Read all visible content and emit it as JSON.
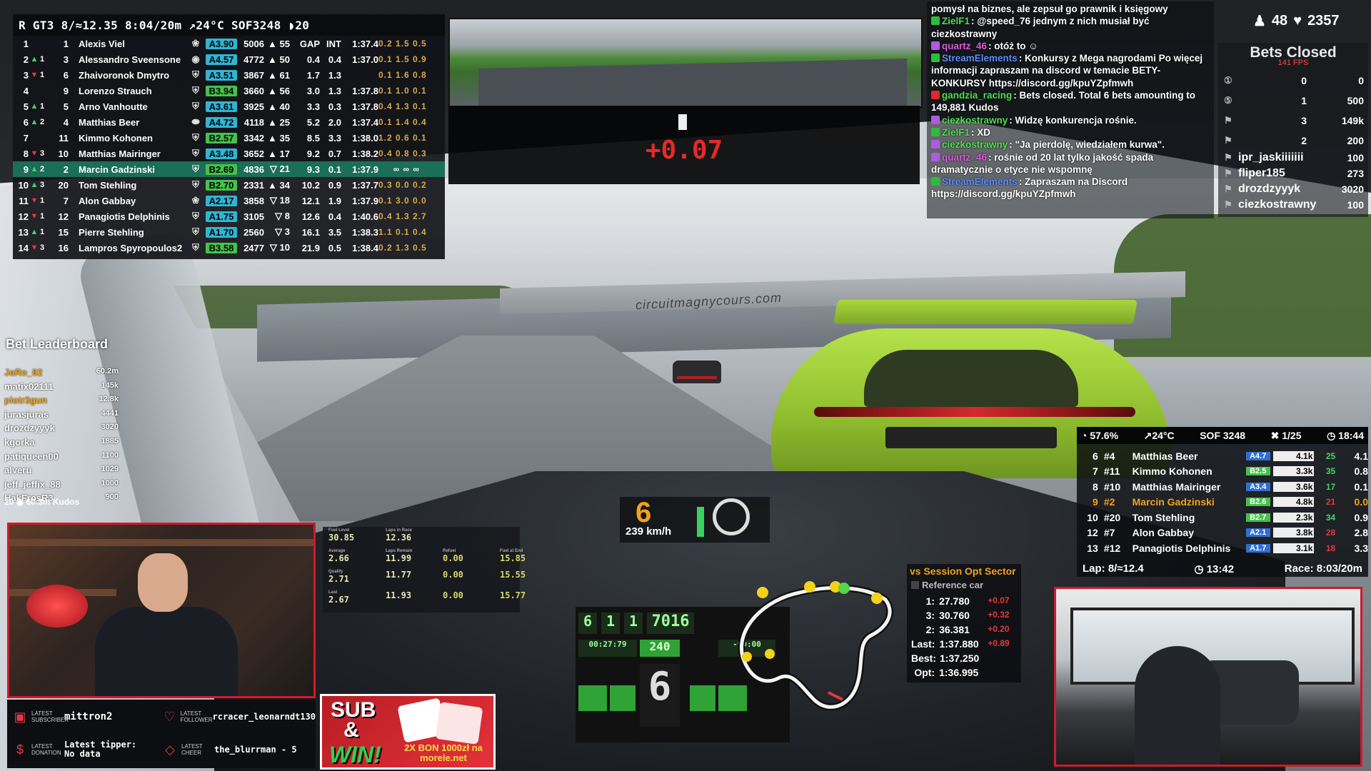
{
  "standings": {
    "header": "R GT3 8/≈12.35 8:04/20m ↗24°C SOF3248 ◗20",
    "col_gap": "GAP",
    "col_int": "INT",
    "rows": [
      {
        "pos": "1",
        "arrow": "",
        "chg": "",
        "num": "1",
        "name": "Alexis Viel",
        "brand": "❀",
        "lic": "A3.90",
        "lic_color": "#2fb5d4",
        "ir": "5006",
        "ir_arrow": "▲",
        "irchg": "55",
        "gap": "GAP",
        "int": "INT",
        "lap": "1:37.4",
        "secs": "0.2 1.5 0.5",
        "hl": false
      },
      {
        "pos": "2",
        "arrow": "▲",
        "chg": "1",
        "num": "3",
        "name": "Alessandro Sveensone",
        "brand": "◉",
        "lic": "A4.57",
        "lic_color": "#2fb5d4",
        "ir": "4772",
        "ir_arrow": "▲",
        "irchg": "50",
        "gap": "0.4",
        "int": "0.4",
        "lap": "1:37.0",
        "secs": "0.1 1.5 0.9",
        "hl": false
      },
      {
        "pos": "3",
        "arrow": "▼",
        "chg": "1",
        "num": "6",
        "name": "Zhaivoronok Dmytro",
        "brand": "⛨",
        "lic": "A3.51",
        "lic_color": "#2fb5d4",
        "ir": "3867",
        "ir_arrow": "▲",
        "irchg": "61",
        "gap": "1.7",
        "int": "1.3",
        "lap": "",
        "secs": "0.1 1.6 0.8",
        "hl": false
      },
      {
        "pos": "4",
        "arrow": "",
        "chg": "",
        "num": "9",
        "name": "Lorenzo Strauch",
        "brand": "⛨",
        "lic": "B3.94",
        "lic_color": "#44c24a",
        "ir": "3660",
        "ir_arrow": "▲",
        "irchg": "56",
        "gap": "3.0",
        "int": "1.3",
        "lap": "1:37.8",
        "secs": "0.1 1.0 0.1",
        "hl": false
      },
      {
        "pos": "5",
        "arrow": "▲",
        "chg": "1",
        "num": "5",
        "name": "Arno Vanhoutte",
        "brand": "⛨",
        "lic": "A3.61",
        "lic_color": "#2fb5d4",
        "ir": "3925",
        "ir_arrow": "▲",
        "irchg": "40",
        "gap": "3.3",
        "int": "0.3",
        "lap": "1:37.8",
        "secs": "0.4 1.3 0.1",
        "hl": false
      },
      {
        "pos": "6",
        "arrow": "▲",
        "chg": "2",
        "num": "4",
        "name": "Matthias Beer",
        "brand": "⬬",
        "lic": "A4.72",
        "lic_color": "#2fb5d4",
        "ir": "4118",
        "ir_arrow": "▲",
        "irchg": "25",
        "gap": "5.2",
        "int": "2.0",
        "lap": "1:37.4",
        "secs": "0.1 1.4 0.4",
        "hl": false
      },
      {
        "pos": "7",
        "arrow": "",
        "chg": "",
        "num": "11",
        "name": "Kimmo Kohonen",
        "brand": "⛨",
        "lic": "B2.57",
        "lic_color": "#44c24a",
        "ir": "3342",
        "ir_arrow": "▲",
        "irchg": "35",
        "gap": "8.5",
        "int": "3.3",
        "lap": "1:38.0",
        "secs": "1.2 0.6 0.1",
        "hl": false
      },
      {
        "pos": "8",
        "arrow": "▼",
        "chg": "3",
        "num": "10",
        "name": "Matthias Mairinger",
        "brand": "⛨",
        "lic": "A3.48",
        "lic_color": "#2fb5d4",
        "ir": "3652",
        "ir_arrow": "▲",
        "irchg": "17",
        "gap": "9.2",
        "int": "0.7",
        "lap": "1:38.2",
        "secs": "0.4 0.8 0.3",
        "hl": false
      },
      {
        "pos": "9",
        "arrow": "▲",
        "chg": "2",
        "num": "2",
        "name": "Marcin Gadzinski",
        "brand": "⛨",
        "lic": "B2.69",
        "lic_color": "#44c24a",
        "ir": "4836",
        "ir_arrow": "▼",
        "irchg": "21",
        "gap": "9.3",
        "int": "0.1",
        "lap": "1:37.9",
        "secs": "∞ ∞ ∞",
        "hl": true
      },
      {
        "pos": "10",
        "arrow": "▲",
        "chg": "3",
        "num": "20",
        "name": "Tom Stehling",
        "brand": "⛨",
        "lic": "B2.70",
        "lic_color": "#44c24a",
        "ir": "2331",
        "ir_arrow": "▲",
        "irchg": "34",
        "gap": "10.2",
        "int": "0.9",
        "lap": "1:37.7",
        "secs": "0.3 0.0 0.2",
        "hl": false
      },
      {
        "pos": "11",
        "arrow": "▼",
        "chg": "1",
        "num": "7",
        "name": "Alon Gabbay",
        "brand": "❀",
        "lic": "A2.17",
        "lic_color": "#2fb5d4",
        "ir": "3858",
        "ir_arrow": "▼",
        "irchg": "18",
        "gap": "12.1",
        "int": "1.9",
        "lap": "1:37.9",
        "secs": "0.1 3.0 0.0",
        "hl": false
      },
      {
        "pos": "12",
        "arrow": "▼",
        "chg": "1",
        "num": "12",
        "name": "Panagiotis Delphinis",
        "brand": "⛨",
        "lic": "A1.75",
        "lic_color": "#2fb5d4",
        "ir": "3105",
        "ir_arrow": "▼",
        "irchg": "8",
        "gap": "12.6",
        "int": "0.4",
        "lap": "1:40.6",
        "secs": "0.4 1.3 2.7",
        "hl": false
      },
      {
        "pos": "13",
        "arrow": "▲",
        "chg": "1",
        "num": "15",
        "name": "Pierre Stehling",
        "brand": "⛨",
        "lic": "A1.70",
        "lic_color": "#2fb5d4",
        "ir": "2560",
        "ir_arrow": "▼",
        "irchg": "3",
        "gap": "16.1",
        "int": "3.5",
        "lap": "1:38.3",
        "secs": "1.1 0.1 0.4",
        "hl": false
      },
      {
        "pos": "14",
        "arrow": "▼",
        "chg": "3",
        "num": "16",
        "name": "Lampros Spyropoulos2",
        "brand": "⛨",
        "lic": "B3.58",
        "lic_color": "#44c24a",
        "ir": "2477",
        "ir_arrow": "▼",
        "irchg": "10",
        "gap": "21.9",
        "int": "0.5",
        "lap": "1:38.4",
        "secs": "0.2 1.3 0.5",
        "hl": false
      }
    ]
  },
  "delta": {
    "value": "+0.07"
  },
  "scene": {
    "bridge_text": "circuitmagnycours.com"
  },
  "chat": [
    {
      "user": "",
      "user_color": "#ffffff",
      "badge": "",
      "text": "pomysł na biznes, ale zepsuł go prawnik i księgowy"
    },
    {
      "user": "ZielF1",
      "user_color": "#4fe04f",
      "badge": "#2ebd3b",
      "text": ": @speed_76 jednym z nich musiał być ciezkostrawny"
    },
    {
      "user": "quartz_46",
      "user_color": "#e05ae0",
      "badge": "#b05ae0",
      "text": ": otóż to ☺"
    },
    {
      "user": "StreamElements",
      "user_color": "#5a8cff",
      "badge": "#2ebd3b",
      "text": ": Konkursy z Mega nagrodami Po więcej informacji zapraszam na discord w temacie BETY-KONKURSY https://discord.gg/kpuYZpfmwh"
    },
    {
      "user": "gandzia_racing",
      "user_color": "#4fe04f",
      "badge": "#e0282a",
      "text": ": Bets closed. Total 6 bets amounting to 149,881 Kudos"
    },
    {
      "user": "ciezkostrawny",
      "user_color": "#4fe04f",
      "badge": "#b05ae0",
      "text": ": Widzę konkurencja rośnie."
    },
    {
      "user": "ZielF1",
      "user_color": "#4fe04f",
      "badge": "#2ebd3b",
      "text": ": XD"
    },
    {
      "user": "ciezkostrawny",
      "user_color": "#4fe04f",
      "badge": "#b05ae0",
      "text": ": \"Ja pierdolę, wiedziałem kurwa\"."
    },
    {
      "user": "quartz_46",
      "user_color": "#e05ae0",
      "badge": "#b05ae0",
      "text": ": rośnie od 20 lat tylko jakość spada dramatycznie o etyce nie wspomnę"
    },
    {
      "user": "StreamElements",
      "user_color": "#5a8cff",
      "badge": "#2ebd3b",
      "text": ": Zapraszam na Discord https://discord.gg/kpuYZpfmwh"
    }
  ],
  "viewers": {
    "count": "48",
    "hearts": "2357"
  },
  "bets": {
    "title": "Bets Closed",
    "fps": "141 FPS",
    "stats": [
      {
        "icon": "①",
        "name": "0",
        "value": "0"
      },
      {
        "icon": "⑤",
        "name": "1",
        "value": "500"
      },
      {
        "icon": "⚑",
        "name": "3",
        "value": "149k"
      },
      {
        "icon": "⚑",
        "name": "2",
        "value": "200"
      }
    ],
    "users": [
      {
        "name": "ipr_jaskiiiiiii",
        "value": "100"
      },
      {
        "name": "fliper185",
        "value": "273"
      },
      {
        "name": "drozdzyyyk",
        "value": "3020"
      },
      {
        "name": "ciezkostrawny",
        "value": "100"
      }
    ]
  },
  "bet_leaderboard": {
    "title": "Bet Leaderboard",
    "rows": [
      {
        "name": "JaRo_82",
        "value": "60.2m",
        "color": "#f2a31a"
      },
      {
        "name": "matix02111",
        "value": "145k",
        "color": "#ffffff"
      },
      {
        "name": "piotr3gun",
        "value": "12.8k",
        "color": "#f2a31a"
      },
      {
        "name": "jurasjuras",
        "value": "4441",
        "color": "#ffffff"
      },
      {
        "name": "drozdzyyyk",
        "value": "3020",
        "color": "#ffffff"
      },
      {
        "name": "kgorka",
        "value": "1885",
        "color": "#ffffff"
      },
      {
        "name": "patiqueen00",
        "value": "1100",
        "color": "#ffffff"
      },
      {
        "name": "alveru",
        "value": "1029",
        "color": "#ffffff"
      },
      {
        "name": "jeff_jeffix_88",
        "value": "1000",
        "color": "#ffffff"
      },
      {
        "name": "HakFrosR3",
        "value": "900",
        "color": "#ffffff"
      }
    ],
    "footer": "20 ◉ 60.3m Kudos"
  },
  "latest": {
    "subscriber_label": "LATEST SUBSCRIBER",
    "subscriber": "mittron2",
    "follower_label": "LATEST FOLLOWER",
    "follower": "rcracer_leonarndt130",
    "donation_label": "LATEST DONATION",
    "donation": "Latest tipper: No data",
    "cheer_label": "LATEST CHEER",
    "cheer": "the_blurrman - 5"
  },
  "fuel": {
    "cells": [
      {
        "cap": "Fuel Level",
        "val": "30.85"
      },
      {
        "cap": "Laps in Race",
        "val": "12.36"
      },
      {
        "cap": "",
        "val": ""
      },
      {
        "cap": "",
        "val": ""
      },
      {
        "cap": "Average",
        "val": "2.66"
      },
      {
        "cap": "Laps Remain",
        "val": "11.99"
      },
      {
        "cap": "Refuel",
        "val": "0.00"
      },
      {
        "cap": "Fuel at End",
        "val": "15.85"
      },
      {
        "cap": "Qualify",
        "val": "2.71"
      },
      {
        "cap": "",
        "val": "11.77"
      },
      {
        "cap": "",
        "val": "0.00"
      },
      {
        "cap": "",
        "val": "15.55"
      },
      {
        "cap": "Last",
        "val": "2.67"
      },
      {
        "cap": "",
        "val": "11.93"
      },
      {
        "cap": "",
        "val": "0.00"
      },
      {
        "cap": "",
        "val": "15.77"
      }
    ]
  },
  "sub_win": {
    "line1": "SUB",
    "line2": "&",
    "line3": "WIN!",
    "bon": "2X BON 1000zł na morele.net"
  },
  "car": {
    "gear": "6",
    "speed": "239 km/h",
    "rpm": "7016",
    "mini_gear": "6",
    "shift": "240",
    "laptime": "00:27:79",
    "gain_loss": "-00:00",
    "tc": "6",
    "eng": "1",
    "heps": "1"
  },
  "sectors_panel": {
    "title": "vs Session Opt Sector",
    "reference": "Reference car",
    "rows": [
      {
        "k": "1:",
        "v": "27.780",
        "d": "+0.07"
      },
      {
        "k": "3:",
        "v": "30.760",
        "d": "+0.32"
      },
      {
        "k": "2:",
        "v": "36.381",
        "d": "+0.20"
      },
      {
        "k": "Last:",
        "v": "1:37.880",
        "d": "+0.89"
      },
      {
        "k": "Best:",
        "v": "1:37.250",
        "d": ""
      },
      {
        "k": "Opt:",
        "v": "1:36.995",
        "d": ""
      }
    ]
  },
  "relative": {
    "header": {
      "fuel": "◔ 57.6%",
      "temp": "↗24°C",
      "sof": "SOF 3248",
      "inc": "✖ 1/25",
      "clock": "◷ 18:44"
    },
    "rows": [
      {
        "pos": "6",
        "num": "#4",
        "name": "Matthias Beer",
        "lic": "A4.7",
        "lic_color": "#2f6fd4",
        "ir": "4.1k",
        "chg": "25",
        "gap": "4.1",
        "hl": false
      },
      {
        "pos": "7",
        "num": "#11",
        "name": "Kimmo Kohonen",
        "lic": "B2.5",
        "lic_color": "#44c24a",
        "ir": "3.3k",
        "chg": "35",
        "gap": "0.8",
        "hl": false
      },
      {
        "pos": "8",
        "num": "#10",
        "name": "Matthias Mairinger",
        "lic": "A3.4",
        "lic_color": "#2f6fd4",
        "ir": "3.6k",
        "chg": "17",
        "gap": "0.1",
        "hl": false
      },
      {
        "pos": "9",
        "num": "#2",
        "name": "Marcin Gadzinski",
        "lic": "B2.6",
        "lic_color": "#44c24a",
        "ir": "4.8k",
        "chg": "21",
        "gap": "0.0",
        "hl": true
      },
      {
        "pos": "10",
        "num": "#20",
        "name": "Tom Stehling",
        "lic": "B2.7",
        "lic_color": "#44c24a",
        "ir": "2.3k",
        "chg": "34",
        "gap": "0.9",
        "hl": false
      },
      {
        "pos": "12",
        "num": "#7",
        "name": "Alon Gabbay",
        "lic": "A2.1",
        "lic_color": "#2f6fd4",
        "ir": "3.8k",
        "chg": "28",
        "gap": "2.8",
        "hl": false
      },
      {
        "pos": "13",
        "num": "#12",
        "name": "Panagiotis Delphinis",
        "lic": "A1.7",
        "lic_color": "#2f6fd4",
        "ir": "3.1k",
        "chg": "18",
        "gap": "3.3",
        "hl": false
      }
    ],
    "footer": {
      "lap": "Lap: 8/≈12.4",
      "time": "◷ 13:42",
      "race": "Race: 8:03/20m"
    }
  },
  "colors": {
    "accent": "#f2a31a",
    "red": "#e23a3a",
    "green": "#46d46a",
    "frame": "#d01a2a"
  }
}
